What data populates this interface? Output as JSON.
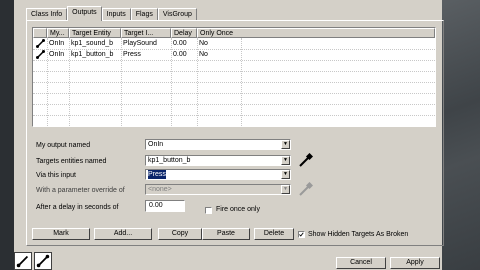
{
  "tabs": [
    "Class Info",
    "Outputs",
    "Inputs",
    "Flags",
    "VisGroup"
  ],
  "active_tab": "Outputs",
  "columns": [
    "My...",
    "Target Entity",
    "Target I...",
    "Delay",
    "Only Once"
  ],
  "rows": [
    {
      "my_output": "OnIn",
      "target_entity": "kp1_sound_b",
      "target_input": "PlaySound",
      "delay": "0.00",
      "only_once": "No"
    },
    {
      "my_output": "OnIn",
      "target_entity": "kp1_button_b",
      "target_input": "Press",
      "delay": "0.00",
      "only_once": "No"
    }
  ],
  "form": {
    "output_label": "My output named",
    "output_value": "OnIn",
    "targets_label": "Targets entities named",
    "targets_value": "kp1_button_b",
    "via_label": "Via this input",
    "via_value": "Press",
    "param_label": "With a parameter override of",
    "param_value": "<none>",
    "delay_label": "After a delay in seconds of",
    "delay_value": "0.00",
    "fire_once_label": "Fire once only",
    "fire_once_checked": false
  },
  "buttons": {
    "mark": "Mark",
    "add": "Add...",
    "copy": "Copy",
    "paste": "Paste",
    "delete": "Delete",
    "show_hidden": "Show Hidden Targets As Broken",
    "cancel": "Cancel",
    "apply": "Apply"
  },
  "show_hidden_checked": true,
  "icons": {
    "connection": "connection-icon",
    "eyedropper": "eyedropper-icon"
  }
}
